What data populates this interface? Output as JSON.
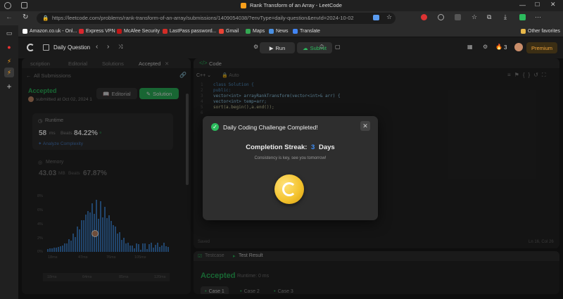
{
  "browser": {
    "tab_title": "Rank Transform of an Array - LeetCode",
    "url": "https://leetcode.com/problems/rank-transform-of-an-array/submissions/1409054038/?envType=daily-question&envId=2024-10-02",
    "bookmarks": [
      {
        "label": "Amazon.co.uk - Onl...",
        "color": "#ffffff"
      },
      {
        "label": "Express VPN",
        "color": "#d9272e"
      },
      {
        "label": "McAfee Security",
        "color": "#c01818"
      },
      {
        "label": "LastPass password...",
        "color": "#d32d27"
      },
      {
        "label": "Gmail",
        "color": "#ea4335"
      },
      {
        "label": "Maps",
        "color": "#34a853"
      },
      {
        "label": "News",
        "color": "#4a90e2"
      },
      {
        "label": "Translate",
        "color": "#4285f4"
      }
    ],
    "other_favorites": "Other favorites"
  },
  "nav": {
    "daily_question": "Daily Question",
    "run": "Run",
    "submit": "Submit",
    "streak_count": "3",
    "premium": "Premium"
  },
  "left": {
    "tabs": [
      "scription",
      "Editorial",
      "Solutions",
      "Accepted"
    ],
    "all_submissions": "All Submissions",
    "status": "Accepted",
    "submitted_at": "submitted at Oct 02, 2024 1",
    "editorial_btn": "Editorial",
    "solution_btn": "Solution",
    "runtime_label": "Runtime",
    "runtime_value": "58",
    "runtime_unit": "ms",
    "beats_label": "Beats",
    "runtime_beats": "84.22%",
    "analyze": "Analyze Complexity",
    "memory_label": "Memory",
    "memory_value": "43.03",
    "memory_unit": "MB",
    "memory_beats": "67.87%",
    "y_ticks": [
      "8%",
      "6%",
      "4%",
      "2%",
      "0%"
    ],
    "x_ticks": [
      "18ms",
      "47ms",
      "76ms",
      "105ms"
    ],
    "x_ticks_2": [
      "18ms",
      "64ms",
      "85ms",
      "120ms"
    ]
  },
  "code": {
    "title": "Code",
    "language": "C++",
    "auto": "Auto",
    "lines": [
      "class Solution {",
      "public:",
      "    vector<int> arrayRankTransform(vector<int>& arr) {",
      "        vector<int> temp=arr;",
      "        sort(a.begin(),a.end());"
    ],
    "line_numbers": [
      "1",
      "2",
      "3",
      "4",
      "5",
      "6"
    ],
    "saved": "Saved",
    "cursor": "Ln 16, Col 26"
  },
  "tests": {
    "testcase": "Testcase",
    "test_result": "Test Result",
    "accepted": "Accepted",
    "runtime": "Runtime: 0 ms",
    "cases": [
      "Case 1",
      "Case 2",
      "Case 3"
    ]
  },
  "modal": {
    "title": "Daily Coding Challenge Completed!",
    "streak_label": "Completion Streak:",
    "streak_number": "3",
    "streak_unit": "Days",
    "subtitle": "Consistency is key, see you tomorrow!"
  },
  "colors": {
    "accent_green": "#2cbb5d",
    "streak_blue": "#3e8ef7",
    "coin_gold": "#f4c430"
  }
}
